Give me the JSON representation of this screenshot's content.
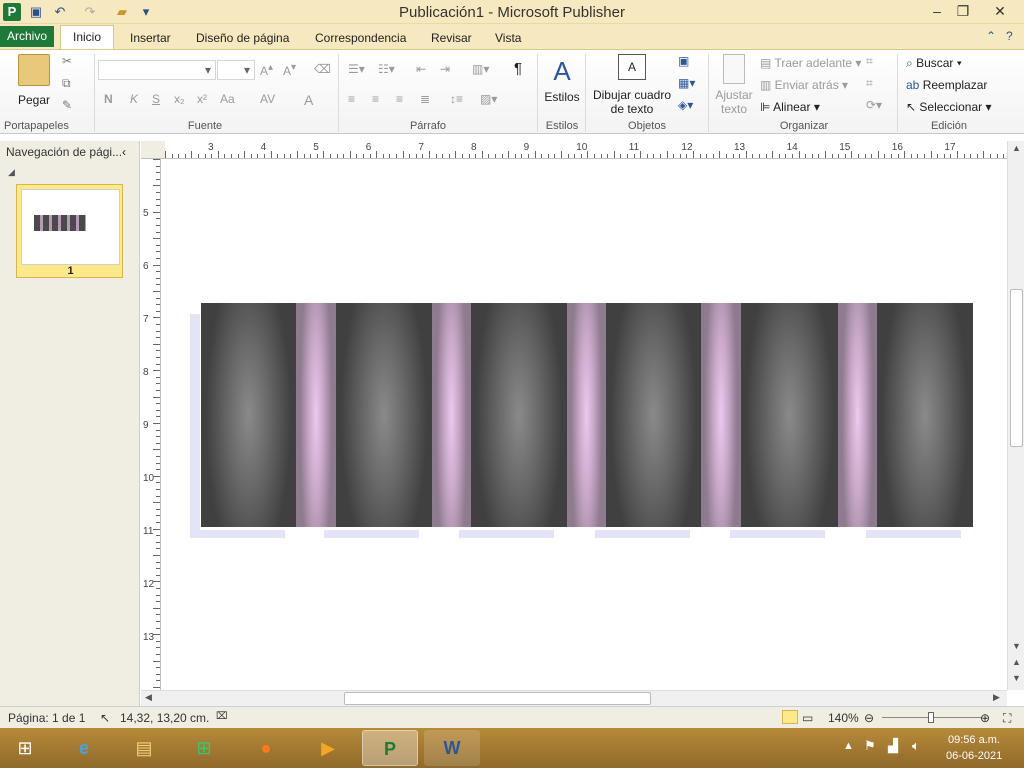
{
  "window": {
    "title": "Publicación1 - Microsoft Publisher",
    "app_icon": "P"
  },
  "tabs": {
    "file": "Archivo",
    "items": [
      "Inicio",
      "Insertar",
      "Diseño de página",
      "Correspondencia",
      "Revisar",
      "Vista"
    ],
    "active": "Inicio"
  },
  "ribbon": {
    "portapapeles": {
      "paste": "Pegar",
      "label": "Portapapeles"
    },
    "fuente": {
      "label": "Fuente",
      "bold": "N",
      "italic": "K",
      "strike": "S",
      "subscript": "x₂",
      "superscript": "x²",
      "case": "Aa",
      "spacing": "AV",
      "color": "A"
    },
    "parrafo": {
      "label": "Párrafo",
      "pilcrow": "¶"
    },
    "estilos": {
      "button": "Estilos",
      "label": "Estilos"
    },
    "objetos": {
      "textbox_line1": "Dibujar cuadro",
      "textbox_line2": "de texto",
      "label": "Objetos"
    },
    "organizar": {
      "wrap_line1": "Ajustar",
      "wrap_line2": "texto",
      "bring_forward": "Traer adelante",
      "send_backward": "Enviar atrás",
      "align": "Alinear",
      "label": "Organizar"
    },
    "edicion": {
      "find": "Buscar",
      "replace": "Reemplazar",
      "select": "Seleccionar",
      "label": "Edición"
    }
  },
  "nav": {
    "title": "Navegación de pági...",
    "page_number": "1"
  },
  "rulers": {
    "h": [
      "3",
      "4",
      "5",
      "6",
      "7",
      "8",
      "9",
      "10",
      "11",
      "12",
      "13",
      "14",
      "15",
      "16",
      "17"
    ],
    "v": [
      "5",
      "6",
      "7",
      "8",
      "9",
      "10",
      "11",
      "12",
      "13"
    ]
  },
  "status": {
    "page": "Página: 1 de 1",
    "coords": "14,32, 13,20 cm.",
    "zoom": "140%"
  },
  "taskbar": {
    "time": "09:56 a.m.",
    "date": "06-06-2021"
  },
  "colors": {
    "tab_file": "#1f7a3a",
    "title_bg": "#f6e9bf",
    "bar_dark": "#404040",
    "bar_mid": "#8a8a8a",
    "gap_pink": "#e9c9ee"
  },
  "icons": [
    "publisher-app-icon",
    "save-icon",
    "undo-icon",
    "redo-icon",
    "open-folder-icon",
    "paste-icon",
    "cut-icon",
    "copy-icon",
    "format-painter-icon",
    "styles-icon",
    "textbox-icon",
    "find-icon",
    "replace-icon",
    "select-icon"
  ]
}
